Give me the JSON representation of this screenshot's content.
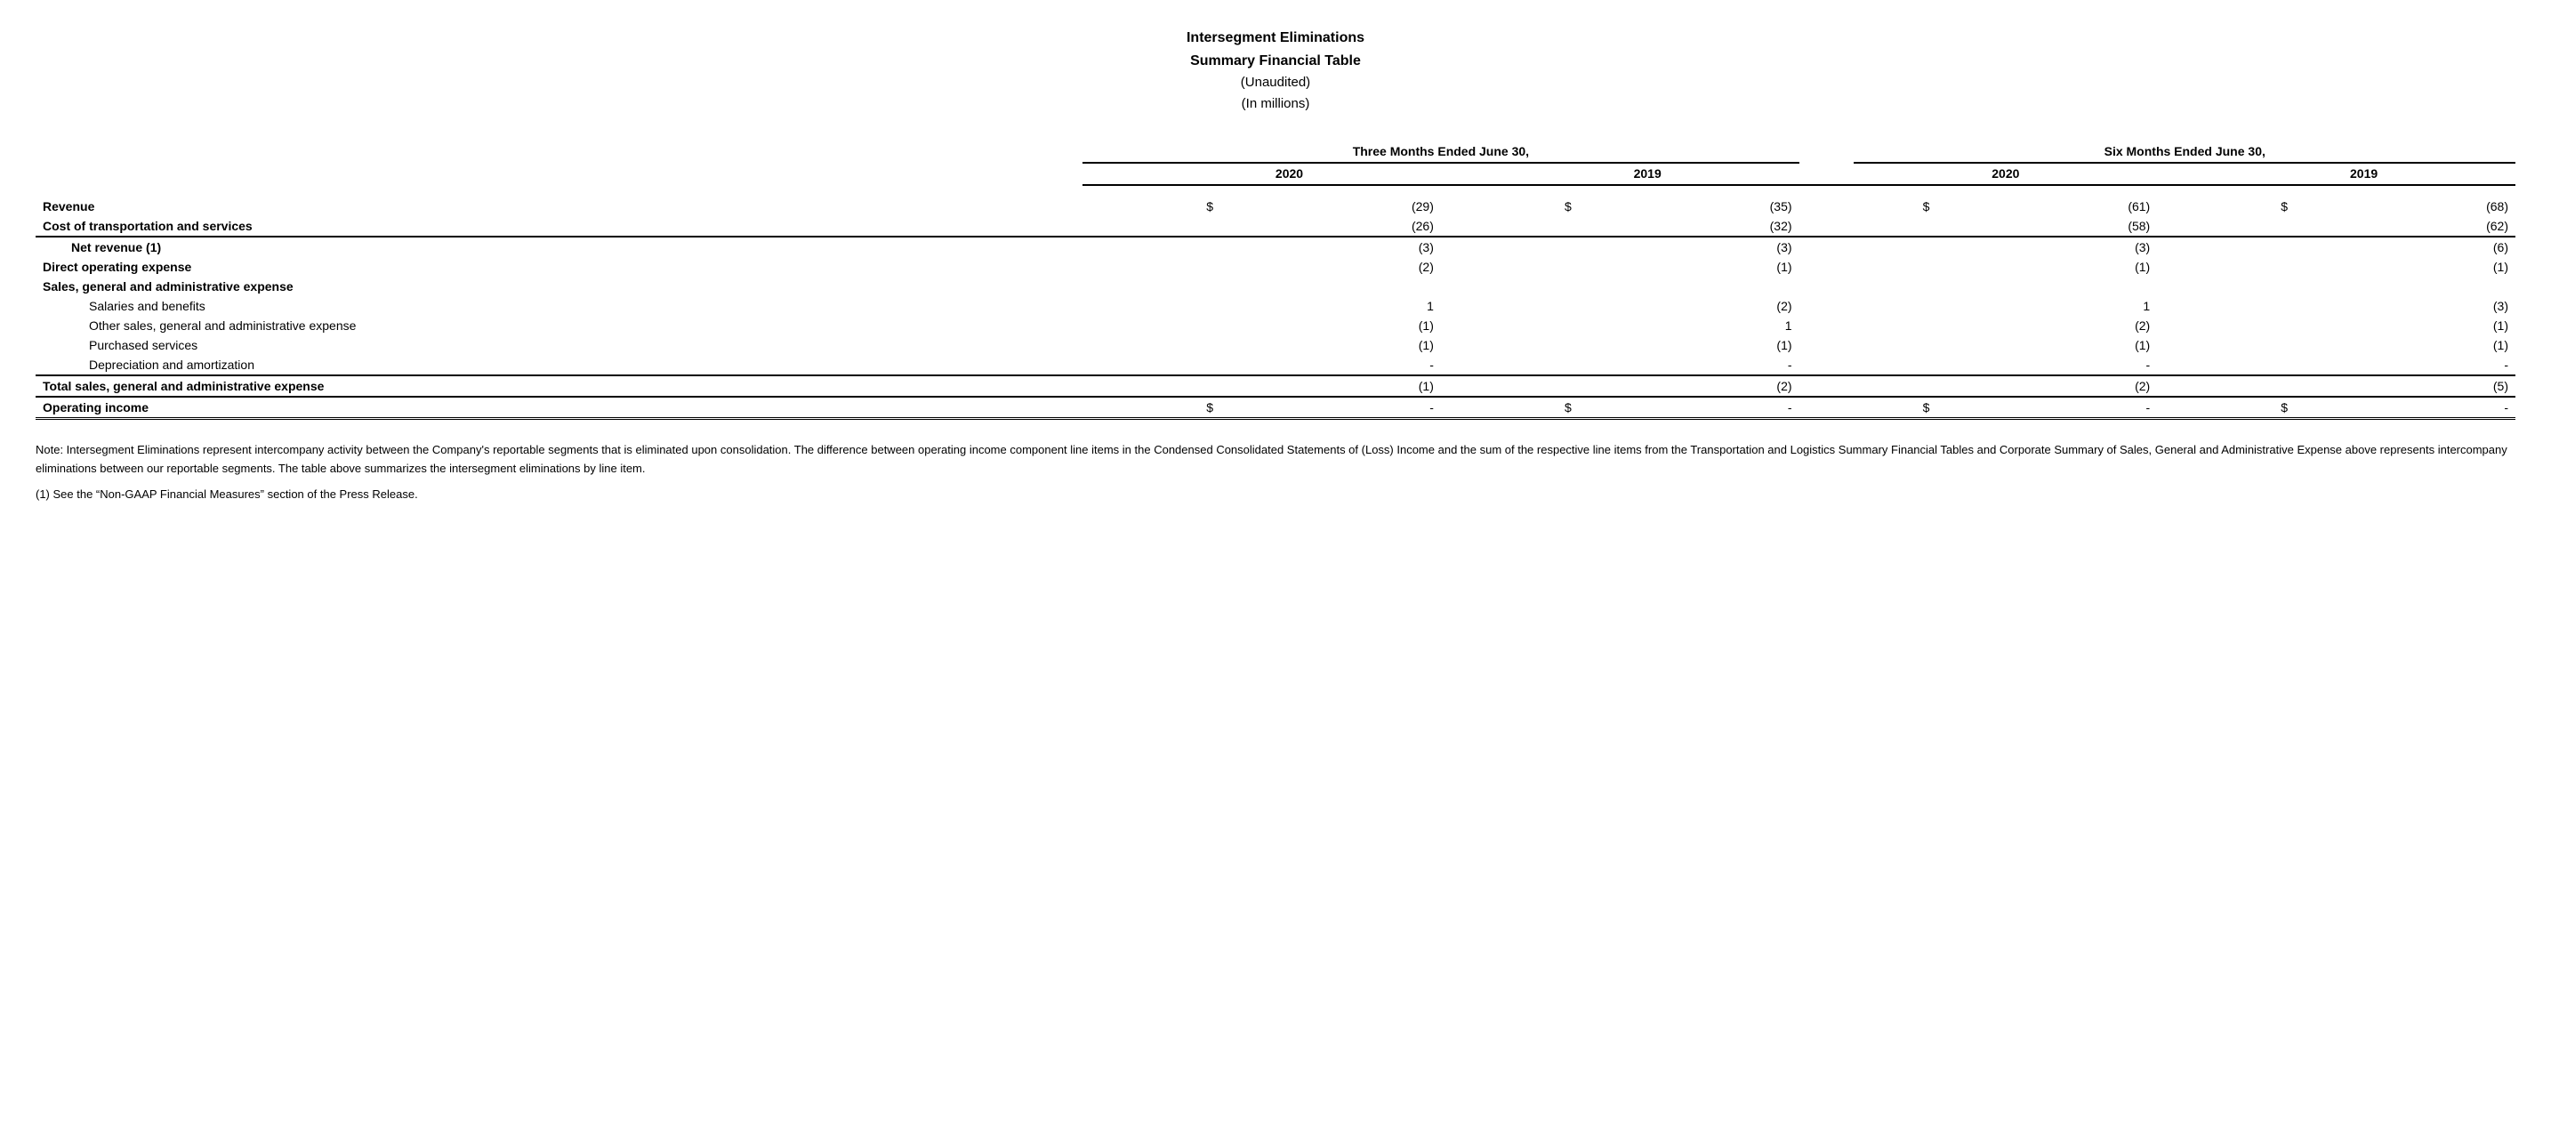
{
  "header": {
    "line1": "Intersegment Eliminations",
    "line2": "Summary Financial Table",
    "line3": "(Unaudited)",
    "line4": "(In millions)"
  },
  "columns": {
    "three_months": {
      "label": "Three Months Ended June 30,",
      "col1_year": "2020",
      "col2_year": "2019"
    },
    "six_months": {
      "label": "Six Months Ended June 30,",
      "col1_year": "2020",
      "col2_year": "2019"
    }
  },
  "rows": [
    {
      "label": "Revenue",
      "bold": true,
      "dollar1": "$",
      "val1": "(29)",
      "dollar2": "$",
      "val2": "(35)",
      "dollar3": "$",
      "val3": "(61)",
      "dollar4": "$",
      "val4": "(68)",
      "border_top": false
    },
    {
      "label": "Cost of transportation and services",
      "bold": true,
      "dollar1": "",
      "val1": "(26)",
      "dollar2": "",
      "val2": "(32)",
      "dollar3": "",
      "val3": "(58)",
      "dollar4": "",
      "val4": "(62)",
      "border_top": false
    },
    {
      "label": "Net revenue (1)",
      "bold": true,
      "indent": 1,
      "dollar1": "",
      "val1": "(3)",
      "dollar2": "",
      "val2": "(3)",
      "dollar3": "",
      "val3": "(3)",
      "dollar4": "",
      "val4": "(6)",
      "border_top": true
    },
    {
      "label": "Direct operating expense",
      "bold": true,
      "dollar1": "",
      "val1": "(2)",
      "dollar2": "",
      "val2": "(1)",
      "dollar3": "",
      "val3": "(1)",
      "dollar4": "",
      "val4": "(1)",
      "border_top": false
    },
    {
      "label": "Sales, general and administrative expense",
      "bold": true,
      "dollar1": "",
      "val1": "",
      "dollar2": "",
      "val2": "",
      "dollar3": "",
      "val3": "",
      "dollar4": "",
      "val4": "",
      "border_top": false
    },
    {
      "label": "Salaries and benefits",
      "bold": false,
      "indent": 2,
      "dollar1": "",
      "val1": "1",
      "dollar2": "",
      "val2": "(2)",
      "dollar3": "",
      "val3": "1",
      "dollar4": "",
      "val4": "(3)",
      "border_top": false
    },
    {
      "label": "Other sales, general and administrative expense",
      "bold": false,
      "indent": 2,
      "dollar1": "",
      "val1": "(1)",
      "dollar2": "",
      "val2": "1",
      "dollar3": "",
      "val3": "(2)",
      "dollar4": "",
      "val4": "(1)",
      "border_top": false
    },
    {
      "label": "Purchased services",
      "bold": false,
      "indent": 2,
      "dollar1": "",
      "val1": "(1)",
      "dollar2": "",
      "val2": "(1)",
      "dollar3": "",
      "val3": "(1)",
      "dollar4": "",
      "val4": "(1)",
      "border_top": false
    },
    {
      "label": "Depreciation and amortization",
      "bold": false,
      "indent": 2,
      "dollar1": "",
      "val1": "-",
      "dollar2": "",
      "val2": "-",
      "dollar3": "",
      "val3": "-",
      "dollar4": "",
      "val4": "-",
      "border_top": false
    },
    {
      "label": "Total sales, general and administrative expense",
      "bold": true,
      "dollar1": "",
      "val1": "(1)",
      "dollar2": "",
      "val2": "(2)",
      "dollar3": "",
      "val3": "(2)",
      "dollar4": "",
      "val4": "(5)",
      "border_top": true
    },
    {
      "label": "Operating income",
      "bold": true,
      "dollar1": "$",
      "val1": "-",
      "dollar2": "$",
      "val2": "-",
      "dollar3": "$",
      "val3": "-",
      "dollar4": "$",
      "val4": "-",
      "border_top": true,
      "double_border": true
    }
  ],
  "note": "Note: Intersegment Eliminations represent intercompany activity between the Company's reportable segments that is eliminated upon consolidation. The difference between operating income component line items in the Condensed Consolidated Statements of (Loss) Income and the sum of the respective line items from the Transportation and Logistics Summary Financial Tables and Corporate Summary of Sales, General and Administrative Expense above represents intercompany eliminations between our reportable segments. The table above summarizes the intersegment eliminations by line item.",
  "footnote": "(1) See the “Non-GAAP Financial Measures” section of the Press Release."
}
